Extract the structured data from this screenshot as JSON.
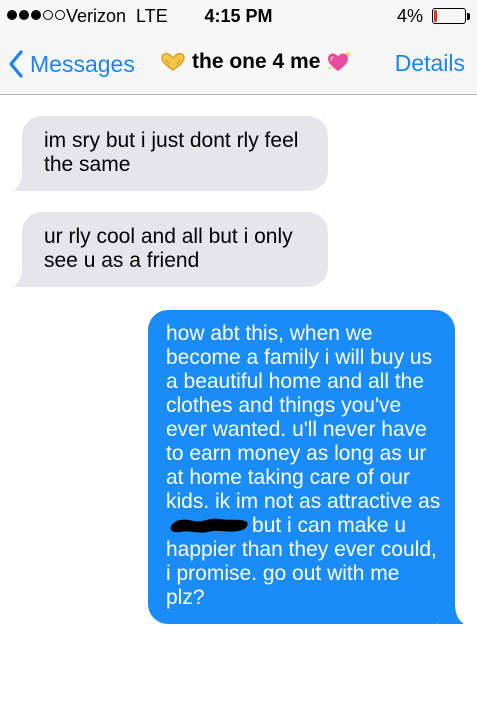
{
  "status_bar": {
    "carrier": "Verizon",
    "network": "LTE",
    "time": "4:15 PM",
    "battery_percent": "4%",
    "battery_level": 0.04,
    "signal_bars": 3,
    "signal_total": 5,
    "battery_fill_color": "#e0302a"
  },
  "nav": {
    "back_label": "Messages",
    "title": "the one 4 me",
    "title_prefix_icon": "heart-hands-emoji",
    "title_suffix_icon": "sparkling-heart-emoji",
    "details_label": "Details",
    "accent_color": "#1a84f5"
  },
  "messages": [
    {
      "direction": "incoming",
      "text": "im sry but i just dont rly feel the same"
    },
    {
      "direction": "incoming",
      "text": "ur rly cool and all but i only see u as a friend"
    },
    {
      "direction": "outgoing",
      "text_before_redaction": "how abt this, when we become a family i will buy us a beautiful home and all the clothes and things you've ever wanted. u'll never have to earn money as long as ur at home taking care of our kids. ik im not as attractive as",
      "redacted": true,
      "text_after_redaction": "but i can make u happier than they ever could, i promise. go out with me plz?"
    }
  ],
  "colors": {
    "incoming_bubble": "#e6e5eb",
    "outgoing_bubble": "#1a8cf8"
  }
}
